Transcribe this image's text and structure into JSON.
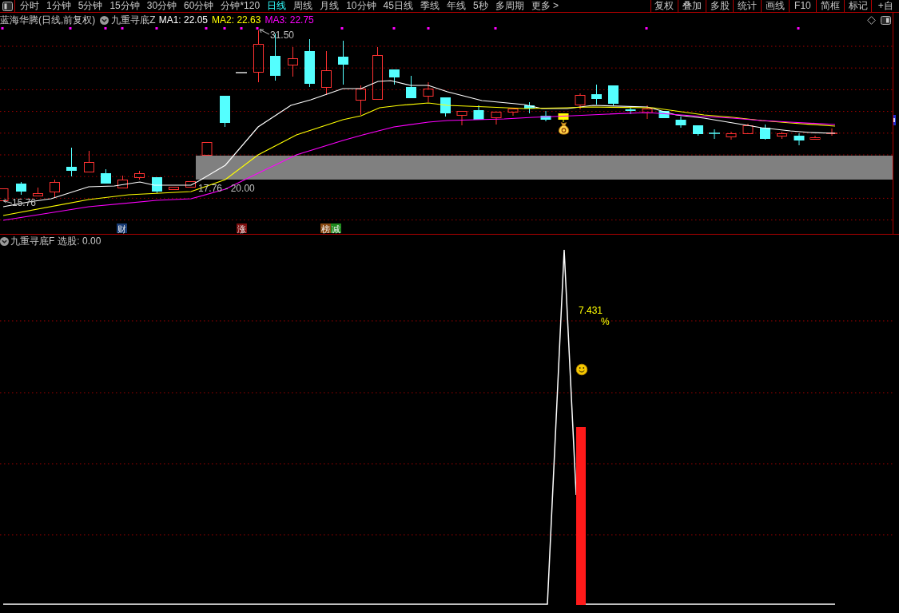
{
  "toolbar": {
    "periods": [
      {
        "label": "分时",
        "selected": false
      },
      {
        "label": "1分钟",
        "selected": false
      },
      {
        "label": "5分钟",
        "selected": false
      },
      {
        "label": "15分钟",
        "selected": false
      },
      {
        "label": "30分钟",
        "selected": false
      },
      {
        "label": "60分钟",
        "selected": false
      },
      {
        "label": "分钟*120",
        "selected": false
      },
      {
        "label": "日线",
        "selected": true
      },
      {
        "label": "周线",
        "selected": false
      },
      {
        "label": "月线",
        "selected": false
      },
      {
        "label": "10分钟",
        "selected": false
      },
      {
        "label": "45日线",
        "selected": false
      },
      {
        "label": "季线",
        "selected": false
      },
      {
        "label": "年线",
        "selected": false
      },
      {
        "label": "5秒",
        "selected": false
      },
      {
        "label": "多周期",
        "selected": false
      },
      {
        "label": "更多 >",
        "selected": false
      }
    ],
    "tools": [
      "复权",
      "叠加",
      "多股",
      "统计",
      "画线",
      "F10",
      "简框",
      "标记",
      "+自"
    ]
  },
  "main_chart": {
    "title": "蓝海华腾(日线,前复权)",
    "indicator": "九重寻底Z",
    "ma_readings": [
      {
        "label": "MA1: 22.05",
        "color": "#ffffff"
      },
      {
        "label": "MA2: 22.63",
        "color": "#ffff00"
      },
      {
        "label": "MA3: 22.75",
        "color": "#ff00ff"
      }
    ],
    "high_label": "31.50",
    "low_label": "15.76",
    "range_label": "17.76 - 20.00",
    "tags": [
      {
        "text": "财",
        "color": "#173a73"
      },
      {
        "text": "涨",
        "color": "#7d0e0e"
      },
      {
        "text": "榜",
        "color": "#8a4b14"
      },
      {
        "text": "减",
        "color": "#1e8a1e"
      }
    ]
  },
  "sub_chart": {
    "indicator": "九重寻底F",
    "reading": "选股: 0.00",
    "value_label": "7.431",
    "unit_label": "%"
  }
}
